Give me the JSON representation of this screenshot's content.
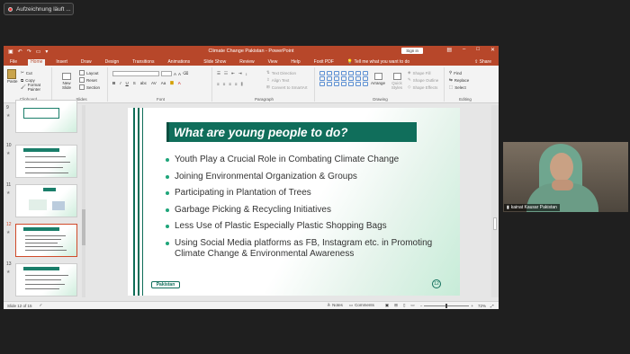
{
  "recording": {
    "label": "Aufzeichnung läuft ..."
  },
  "titlebar": {
    "title": "Climate Change Pakistan  -  PowerPoint",
    "signin": "Sign in",
    "brand_color": "#b7472a"
  },
  "tabs": [
    {
      "label": "File"
    },
    {
      "label": "Home"
    },
    {
      "label": "Insert"
    },
    {
      "label": "Draw"
    },
    {
      "label": "Design"
    },
    {
      "label": "Transitions"
    },
    {
      "label": "Animations"
    },
    {
      "label": "Slide Show"
    },
    {
      "label": "Review"
    },
    {
      "label": "View"
    },
    {
      "label": "Help"
    },
    {
      "label": "Foxit PDF"
    }
  ],
  "tellme": "Tell me what you want to do",
  "share": "Share",
  "ribbon": {
    "clipboard": {
      "paste": "Paste",
      "cut": "Cut",
      "copy": "Copy",
      "format_painter": "Format Painter",
      "label": "Clipboard"
    },
    "slides": {
      "new_slide": "New Slide",
      "layout": "Layout",
      "reset": "Reset",
      "section": "Section",
      "label": "Slides"
    },
    "font": {
      "label": "Font"
    },
    "paragraph": {
      "text_direction": "Text Direction",
      "align_text": "Align Text",
      "convert_smartart": "Convert to SmartArt",
      "label": "Paragraph"
    },
    "drawing": {
      "arrange": "Arrange",
      "quick_styles": "Quick Styles",
      "shape_fill": "Shape Fill",
      "shape_outline": "Shape Outline",
      "shape_effects": "Shape Effects",
      "label": "Drawing"
    },
    "editing": {
      "find": "Find",
      "replace": "Replace",
      "select": "Select",
      "label": "Editing"
    }
  },
  "thumbnails": [
    {
      "num": "9"
    },
    {
      "num": "10"
    },
    {
      "num": "11"
    },
    {
      "num": "12"
    },
    {
      "num": "13"
    }
  ],
  "slide": {
    "title": "What are young people to do?",
    "bullets": [
      "Youth Play a Crucial Role in Combating Climate Change",
      "Joining Environmental Organization & Groups",
      "Participating in Plantation of Trees",
      "Garbage Picking & Recycling Initiatives",
      "Less Use of Plastic Especially Plastic Shopping Bags",
      "Using Social Media platforms as FB, Instagram etc. in Promoting Climate Change & Environmental Awareness"
    ],
    "badge": "Pakistan",
    "number": "12",
    "accent_color": "#106e5b"
  },
  "status": {
    "slide_info": "Slide 12 of 15",
    "notes": "Notes",
    "comments": "Comments",
    "zoom": "72%"
  },
  "video": {
    "participant": "kainat Kausar Pakistan"
  }
}
